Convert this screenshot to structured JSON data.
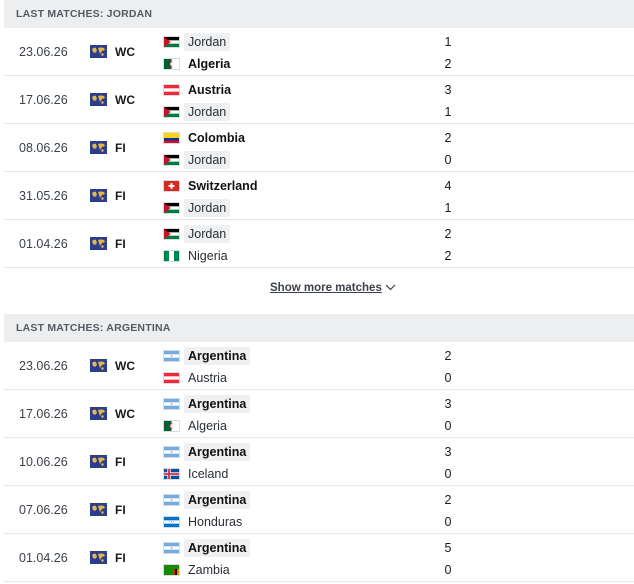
{
  "sections": [
    {
      "title": "LAST MATCHES: JORDAN",
      "matches": [
        {
          "date": "23.06.26",
          "comp": "WC",
          "home": {
            "name": "Jordan",
            "flag": "jordan",
            "score": "1",
            "highlight": true,
            "winner": false
          },
          "away": {
            "name": "Algeria",
            "flag": "algeria",
            "score": "2",
            "highlight": false,
            "winner": true
          }
        },
        {
          "date": "17.06.26",
          "comp": "WC",
          "home": {
            "name": "Austria",
            "flag": "austria",
            "score": "3",
            "highlight": false,
            "winner": true
          },
          "away": {
            "name": "Jordan",
            "flag": "jordan",
            "score": "1",
            "highlight": true,
            "winner": false
          }
        },
        {
          "date": "08.06.26",
          "comp": "FI",
          "home": {
            "name": "Colombia",
            "flag": "colombia",
            "score": "2",
            "highlight": false,
            "winner": true
          },
          "away": {
            "name": "Jordan",
            "flag": "jordan",
            "score": "0",
            "highlight": true,
            "winner": false
          }
        },
        {
          "date": "31.05.26",
          "comp": "FI",
          "home": {
            "name": "Switzerland",
            "flag": "switzerland",
            "score": "4",
            "highlight": false,
            "winner": true
          },
          "away": {
            "name": "Jordan",
            "flag": "jordan",
            "score": "1",
            "highlight": true,
            "winner": false
          }
        },
        {
          "date": "01.04.26",
          "comp": "FI",
          "home": {
            "name": "Jordan",
            "flag": "jordan",
            "score": "2",
            "highlight": true,
            "winner": false
          },
          "away": {
            "name": "Nigeria",
            "flag": "nigeria",
            "score": "2",
            "highlight": false,
            "winner": false
          }
        }
      ]
    },
    {
      "title": "LAST MATCHES: ARGENTINA",
      "matches": [
        {
          "date": "23.06.26",
          "comp": "WC",
          "home": {
            "name": "Argentina",
            "flag": "argentina",
            "score": "2",
            "highlight": true,
            "winner": true
          },
          "away": {
            "name": "Austria",
            "flag": "austria",
            "score": "0",
            "highlight": false,
            "winner": false
          }
        },
        {
          "date": "17.06.26",
          "comp": "WC",
          "home": {
            "name": "Argentina",
            "flag": "argentina",
            "score": "3",
            "highlight": true,
            "winner": true
          },
          "away": {
            "name": "Algeria",
            "flag": "algeria",
            "score": "0",
            "highlight": false,
            "winner": false
          }
        },
        {
          "date": "10.06.26",
          "comp": "FI",
          "home": {
            "name": "Argentina",
            "flag": "argentina",
            "score": "3",
            "highlight": true,
            "winner": true
          },
          "away": {
            "name": "Iceland",
            "flag": "iceland",
            "score": "0",
            "highlight": false,
            "winner": false
          }
        },
        {
          "date": "07.06.26",
          "comp": "FI",
          "home": {
            "name": "Argentina",
            "flag": "argentina",
            "score": "2",
            "highlight": true,
            "winner": true
          },
          "away": {
            "name": "Honduras",
            "flag": "honduras",
            "score": "0",
            "highlight": false,
            "winner": false
          }
        },
        {
          "date": "01.04.26",
          "comp": "FI",
          "home": {
            "name": "Argentina",
            "flag": "argentina",
            "score": "5",
            "highlight": true,
            "winner": true
          },
          "away": {
            "name": "Zambia",
            "flag": "zambia",
            "score": "0",
            "highlight": false,
            "winner": false
          }
        }
      ]
    }
  ],
  "show_more": {
    "label": "Show more matches",
    "icon": "chevron-down-icon"
  },
  "competition_icon": "world-map-icon",
  "colors": {
    "header_bg": "#eceef0",
    "header_text": "#555b62",
    "highlight_bg": "#eef0f2",
    "divider": "#e4e6e8",
    "comp_icon_bg": "#2d3d8e",
    "comp_icon_land": "#e0b84a"
  }
}
